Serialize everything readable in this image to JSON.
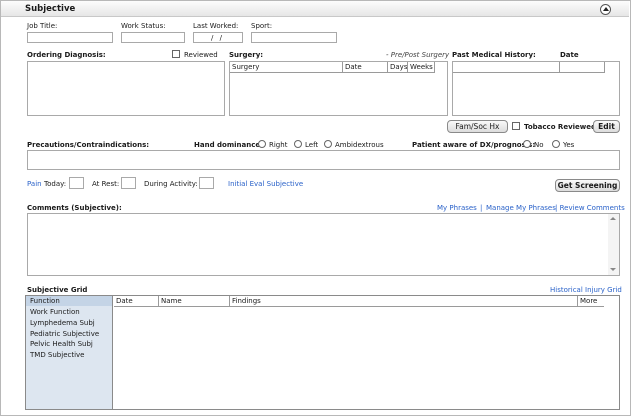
{
  "section": {
    "title": "Subjective"
  },
  "top_fields": {
    "job_title_label": "Job Title:",
    "work_status_label": "Work Status:",
    "last_worked_label": "Last Worked:",
    "last_worked_value": "/ /",
    "sport_label": "Sport:"
  },
  "ordering_diagnosis": {
    "label": "Ordering Diagnosis:",
    "reviewed_label": "Reviewed"
  },
  "surgery": {
    "label": "Surgery:",
    "note": "- Pre/Post Surgery",
    "columns": [
      "Surgery",
      "Date",
      "Days",
      "Weeks"
    ]
  },
  "past_medical_history": {
    "label": "Past Medical History:",
    "date_label": "Date"
  },
  "buttons": {
    "fam_soc": "Fam/Soc Hx",
    "tobacco_reviewed": "Tobacco Reviewed",
    "edit": "Edit",
    "get_screening": "Get Screening"
  },
  "precautions": {
    "label": "Precautions/Contraindications:"
  },
  "hand_dominance": {
    "label": "Hand dominance:",
    "options": [
      "Right",
      "Left",
      "Ambidextrous"
    ]
  },
  "patient_aware": {
    "label": "Patient aware of DX/prognosis:",
    "options": [
      "No",
      "Yes"
    ]
  },
  "pain": {
    "link": "Pain",
    "today_label": "Today:",
    "at_rest_label": "At Rest:",
    "during_activity_label": "During Activity:",
    "initial_eval_link": "Initial Eval Subjective"
  },
  "comments": {
    "label": "Comments (Subjective):",
    "my_phrases": "My Phrases",
    "separator": "|",
    "manage_phrases": "Manage My Phrases",
    "review_comments": "| Review Comments"
  },
  "subjective_grid": {
    "label": "Subjective Grid",
    "historical_link": "Historical Injury Grid",
    "list": [
      "Function",
      "Work Function",
      "Lymphedema Subj",
      "Pediatric Subjective",
      "Pelvic Health Subj",
      "TMD Subjective"
    ],
    "columns": [
      "Date",
      "Name",
      "Findings",
      "More"
    ]
  },
  "colors": {
    "link": "#2a62c9",
    "list_bg": "#dde6f0",
    "list_selected": "#c4d4e6"
  }
}
